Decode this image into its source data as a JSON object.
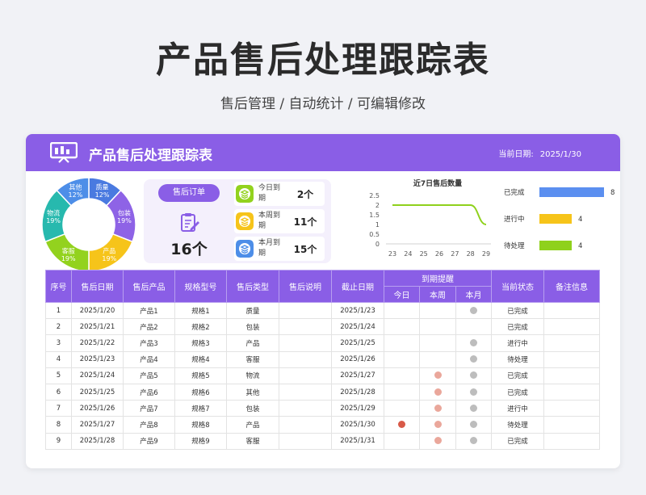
{
  "page": {
    "title": "产品售后处理跟踪表",
    "subtitle": "售后管理 /  自动统计  /  可编辑修改"
  },
  "card": {
    "title": "产品售后处理跟踪表",
    "date_label": "当前日期:",
    "date_value": "2025/1/30",
    "icon": "presentation-board-icon",
    "accent": "#8a5ee6"
  },
  "donut": {
    "segments": [
      {
        "label": "质量",
        "pct": "12%",
        "value": 12,
        "color": "#4a7ae0"
      },
      {
        "label": "包装",
        "pct": "19%",
        "value": 19,
        "color": "#8e63e6"
      },
      {
        "label": "产品",
        "pct": "19%",
        "value": 19,
        "color": "#f6c41a"
      },
      {
        "label": "客服",
        "pct": "19%",
        "value": 19,
        "color": "#93d21e"
      },
      {
        "label": "物流",
        "pct": "19%",
        "value": 19,
        "color": "#27b9ae"
      },
      {
        "label": "其他",
        "pct": "12%",
        "value": 12,
        "color": "#4d8ee8"
      }
    ]
  },
  "orders": {
    "tag": "售后订单",
    "icon": "clipboard-edit-icon",
    "count": "16个",
    "due": [
      {
        "label": "今日到期",
        "value": "2个",
        "color": "#93d21e",
        "icon": "stack-icon"
      },
      {
        "label": "本周到期",
        "value": "11个",
        "color": "#f6c41a",
        "icon": "stack-icon"
      },
      {
        "label": "本月到期",
        "value": "15个",
        "color": "#4d8ee8",
        "icon": "stack-icon"
      }
    ]
  },
  "chart_data": [
    {
      "type": "line",
      "title": "近7日售后数量",
      "x": [
        "23",
        "24",
        "25",
        "26",
        "27",
        "28",
        "29"
      ],
      "series": [
        {
          "values": [
            2,
            2,
            2,
            2,
            2,
            2,
            1
          ]
        }
      ],
      "ylim": [
        0,
        2.5
      ],
      "yticks": [
        "0",
        "0.5",
        "1",
        "1.5",
        "2",
        "2.5"
      ],
      "color": "#8fd11c",
      "grid": false
    },
    {
      "type": "bar",
      "orientation": "horizontal",
      "categories": [
        "已完成",
        "进行中",
        "待处理"
      ],
      "values": [
        8,
        4,
        4
      ],
      "labels": [
        "8",
        "4",
        "4"
      ],
      "colors": [
        "#5b8ff0",
        "#f6c41a",
        "#8fd11c"
      ],
      "xlim": [
        0,
        8
      ]
    }
  ],
  "table": {
    "headers": {
      "seq": "序号",
      "date": "售后日期",
      "product": "售后产品",
      "model": "规格型号",
      "type": "售后类型",
      "desc": "售后说明",
      "deadline": "截止日期",
      "reminder": "到期提醒",
      "today": "今日",
      "week": "本周",
      "month": "本月",
      "status": "当前状态",
      "note": "备注信息"
    },
    "dot_colors": {
      "today": "#d85a48",
      "week": "#eaa79b",
      "month": "#bdbdbd"
    },
    "rows": [
      {
        "seq": "1",
        "date": "2025/1/20",
        "product": "产品1",
        "model": "规格1",
        "type": "质量",
        "desc": "",
        "deadline": "2025/1/23",
        "today": false,
        "week": false,
        "month": true,
        "status": "已完成",
        "note": ""
      },
      {
        "seq": "2",
        "date": "2025/1/21",
        "product": "产品2",
        "model": "规格2",
        "type": "包装",
        "desc": "",
        "deadline": "2025/1/24",
        "today": false,
        "week": false,
        "month": false,
        "status": "已完成",
        "note": ""
      },
      {
        "seq": "3",
        "date": "2025/1/22",
        "product": "产品3",
        "model": "规格3",
        "type": "产品",
        "desc": "",
        "deadline": "2025/1/25",
        "today": false,
        "week": false,
        "month": true,
        "status": "进行中",
        "note": ""
      },
      {
        "seq": "4",
        "date": "2025/1/23",
        "product": "产品4",
        "model": "规格4",
        "type": "客服",
        "desc": "",
        "deadline": "2025/1/26",
        "today": false,
        "week": false,
        "month": true,
        "status": "待处理",
        "note": ""
      },
      {
        "seq": "5",
        "date": "2025/1/24",
        "product": "产品5",
        "model": "规格5",
        "type": "物流",
        "desc": "",
        "deadline": "2025/1/27",
        "today": false,
        "week": true,
        "month": true,
        "status": "已完成",
        "note": ""
      },
      {
        "seq": "6",
        "date": "2025/1/25",
        "product": "产品6",
        "model": "规格6",
        "type": "其他",
        "desc": "",
        "deadline": "2025/1/28",
        "today": false,
        "week": true,
        "month": true,
        "status": "已完成",
        "note": ""
      },
      {
        "seq": "7",
        "date": "2025/1/26",
        "product": "产品7",
        "model": "规格7",
        "type": "包装",
        "desc": "",
        "deadline": "2025/1/29",
        "today": false,
        "week": true,
        "month": true,
        "status": "进行中",
        "note": ""
      },
      {
        "seq": "8",
        "date": "2025/1/27",
        "product": "产品8",
        "model": "规格8",
        "type": "产品",
        "desc": "",
        "deadline": "2025/1/30",
        "today": true,
        "week": true,
        "month": true,
        "status": "待处理",
        "note": ""
      },
      {
        "seq": "9",
        "date": "2025/1/28",
        "product": "产品9",
        "model": "规格9",
        "type": "客服",
        "desc": "",
        "deadline": "2025/1/31",
        "today": false,
        "week": true,
        "month": true,
        "status": "已完成",
        "note": ""
      }
    ]
  }
}
